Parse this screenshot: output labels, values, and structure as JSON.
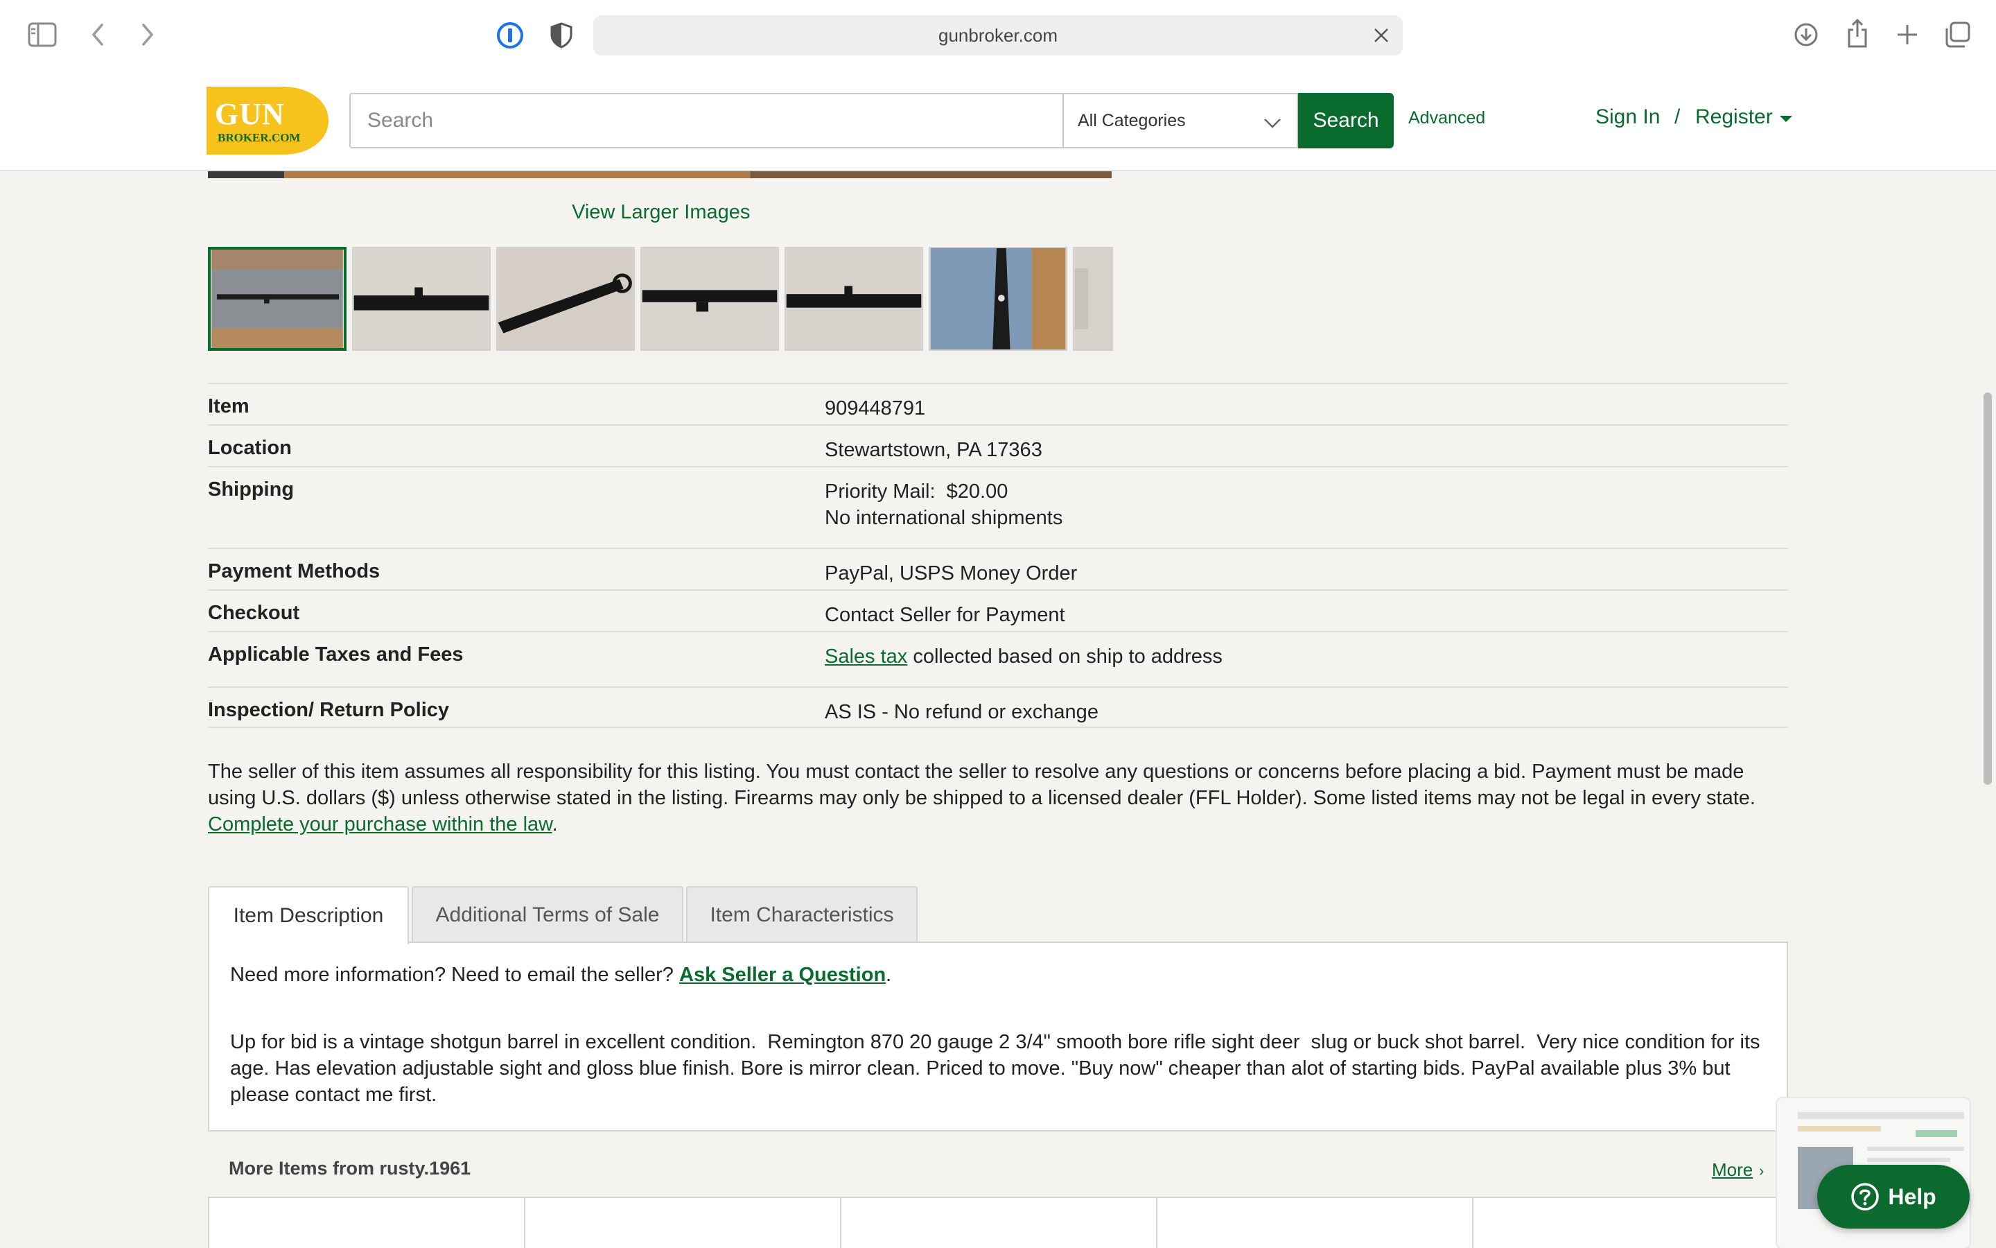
{
  "browser": {
    "url": "gunbroker.com"
  },
  "header": {
    "logo_text_top": "GUN",
    "logo_text_bottom": "BROKER.COM",
    "search_placeholder": "Search",
    "category_selected": "All Categories",
    "search_button": "Search",
    "advanced_link": "Advanced",
    "sign_in": "Sign In",
    "separator": "/",
    "register": "Register"
  },
  "gallery": {
    "view_larger": "View Larger Images",
    "thumbnail_count": 7,
    "selected_index": 0
  },
  "details": [
    {
      "label": "Item",
      "value": "909448791"
    },
    {
      "label": "Location",
      "value": "Stewartstown, PA 17363"
    },
    {
      "label": "Shipping",
      "value": "Priority Mail:  $20.00",
      "value2": "No international shipments"
    },
    {
      "label": "Payment Methods",
      "value": "PayPal, USPS Money Order"
    },
    {
      "label": "Checkout",
      "value": "Contact Seller for Payment"
    },
    {
      "label": "Applicable Taxes and Fees",
      "value_link": "Sales tax",
      "value_rest": " collected based on ship to address"
    },
    {
      "label": "Inspection/ Return Policy",
      "value": "AS IS - No refund or exchange"
    }
  ],
  "disclaimer": {
    "text": "The seller of this item assumes all responsibility for this listing. You must contact the seller to resolve any questions or concerns before placing a bid. Payment must be made using U.S. dollars ($) unless otherwise stated in the listing. Firearms may only be shipped to a licensed dealer (FFL Holder). Some listed items may not be legal in every state.",
    "link": "Complete your purchase within the law",
    "end": "."
  },
  "tabs": [
    {
      "label": "Item Description",
      "active": true
    },
    {
      "label": "Additional Terms of Sale",
      "active": false
    },
    {
      "label": "Item Characteristics",
      "active": false
    }
  ],
  "tab_panel": {
    "ask_prefix": "Need more information? Need to email the seller? ",
    "ask_link": "Ask Seller a Question",
    "ask_suffix": ".",
    "description": "Up for bid is a vintage shotgun barrel in excellent condition.  Remington 870 20 gauge 2 3/4\" smooth bore rifle sight deer  slug or buck shot barrel.  Very nice condition for its age. Has elevation adjustable sight and gloss blue finish. Bore is mirror clean. Priced to move. \"Buy now\" cheaper than alot of starting bids. PayPal available plus 3% but please contact me first."
  },
  "more_items": {
    "title": "More Items from rusty.1961",
    "more_link": "More",
    "chevron": "›"
  },
  "help": {
    "label": "Help"
  },
  "colors": {
    "brand_green": "#0a6b2e",
    "logo_yellow": "#f6c21c",
    "page_bg": "#f4f3ef"
  }
}
